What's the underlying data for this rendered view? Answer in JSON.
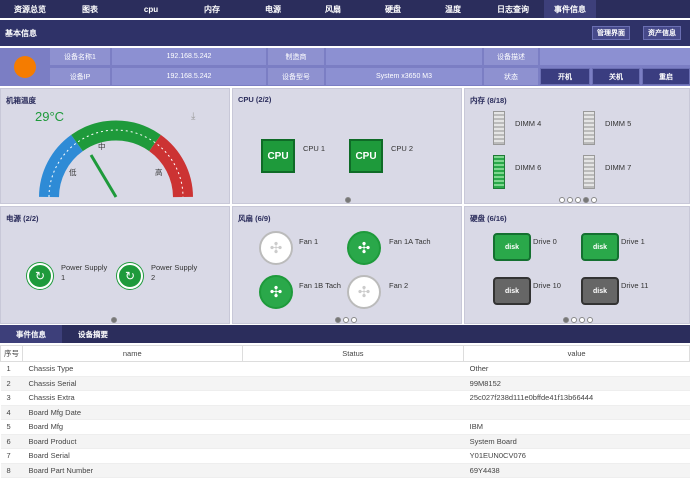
{
  "nav": [
    "资源总览",
    "图表",
    "cpu",
    "内存",
    "电源",
    "风扇",
    "硬盘",
    "温度",
    "日志查询",
    "事件信息"
  ],
  "basic": {
    "title": "基本信息",
    "btn_manage": "管理界面",
    "btn_asset": "资产信息",
    "device_name_label": "设备名称1",
    "device_name_value": "192.168.5.242",
    "vendor_label": "制造商",
    "vendor_value": "",
    "desc_label": "设备描述",
    "desc_value": "",
    "ip_label": "设备IP",
    "ip_value": "192.168.5.242",
    "model_label": "设备型号",
    "model_value": "System x3650 M3",
    "status_label": "状态",
    "btn_power_on": "开机",
    "btn_power_off": "关机",
    "btn_restart": "重启"
  },
  "temperature": {
    "title": "机箱温度",
    "value": "29°C",
    "low": "低",
    "mid": "中",
    "high": "高"
  },
  "cpu": {
    "title": "CPU (2/2)",
    "chip_text": "CPU",
    "items": [
      "CPU 1",
      "CPU 2"
    ]
  },
  "memory": {
    "title": "内存 (8/18)",
    "items": [
      "DIMM 4",
      "DIMM 5",
      "DIMM 6",
      "DIMM 7"
    ]
  },
  "power": {
    "title": "电源 (2/2)",
    "items": [
      "Power Supply\n1",
      "Power Supply\n2"
    ]
  },
  "fans": {
    "title": "风扇 (6/9)",
    "items": [
      "Fan 1",
      "Fan 1A Tach",
      "Fan 1B Tach",
      "Fan 2"
    ]
  },
  "disks": {
    "title": "硬盘 (6/16)",
    "items": [
      "Drive 0",
      "Drive 1",
      "Drive 10",
      "Drive 11"
    ]
  },
  "bottom_tabs": [
    "事件信息",
    "设备摘要"
  ],
  "table": {
    "headers": [
      "序号",
      "name",
      "Status",
      "value"
    ],
    "rows": [
      [
        "1",
        "Chassis Type",
        "",
        "Other"
      ],
      [
        "2",
        "Chassis Serial",
        "",
        "99M8152"
      ],
      [
        "3",
        "Chassis Extra",
        "",
        "25c027f238d111e0bffde41f13b66444"
      ],
      [
        "4",
        "Board Mfg Date",
        "",
        ""
      ],
      [
        "5",
        "Board Mfg",
        "",
        "IBM"
      ],
      [
        "6",
        "Board Product",
        "",
        "System Board"
      ],
      [
        "7",
        "Board Serial",
        "",
        "Y01EUN0CV076"
      ],
      [
        "8",
        "Board Part Number",
        "",
        "69Y4438"
      ]
    ]
  }
}
